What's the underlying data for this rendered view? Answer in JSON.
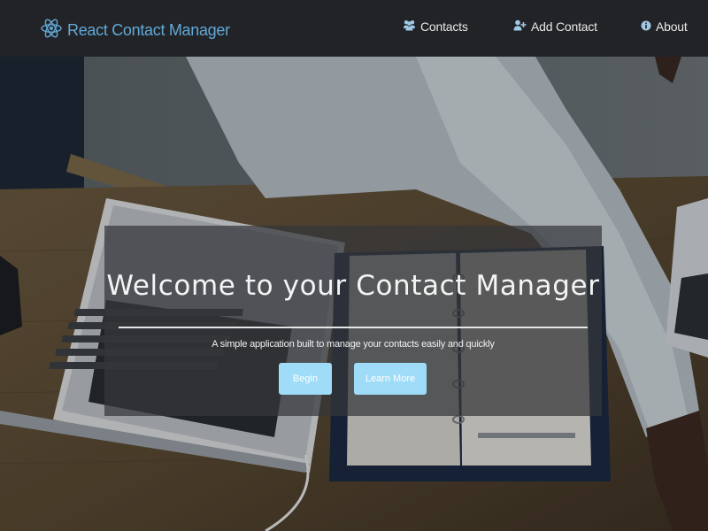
{
  "nav": {
    "brand": "React Contact Manager",
    "links": [
      {
        "label": "Contacts",
        "icon": "users-icon"
      },
      {
        "label": "Add Contact",
        "icon": "user-plus-icon"
      },
      {
        "label": "About",
        "icon": "info-circle-icon"
      }
    ]
  },
  "hero": {
    "title": "Welcome to your Contact Manager",
    "subtitle": "A simple application built to manage your contacts easily and quickly",
    "buttons": {
      "begin": "Begin",
      "learn_more": "Learn More"
    }
  },
  "colors": {
    "navbar_bg": "#222327",
    "brand": "#61a9d6",
    "button_bg": "#9fdcf7",
    "overlay": "rgba(52,54,58,0.72)"
  }
}
